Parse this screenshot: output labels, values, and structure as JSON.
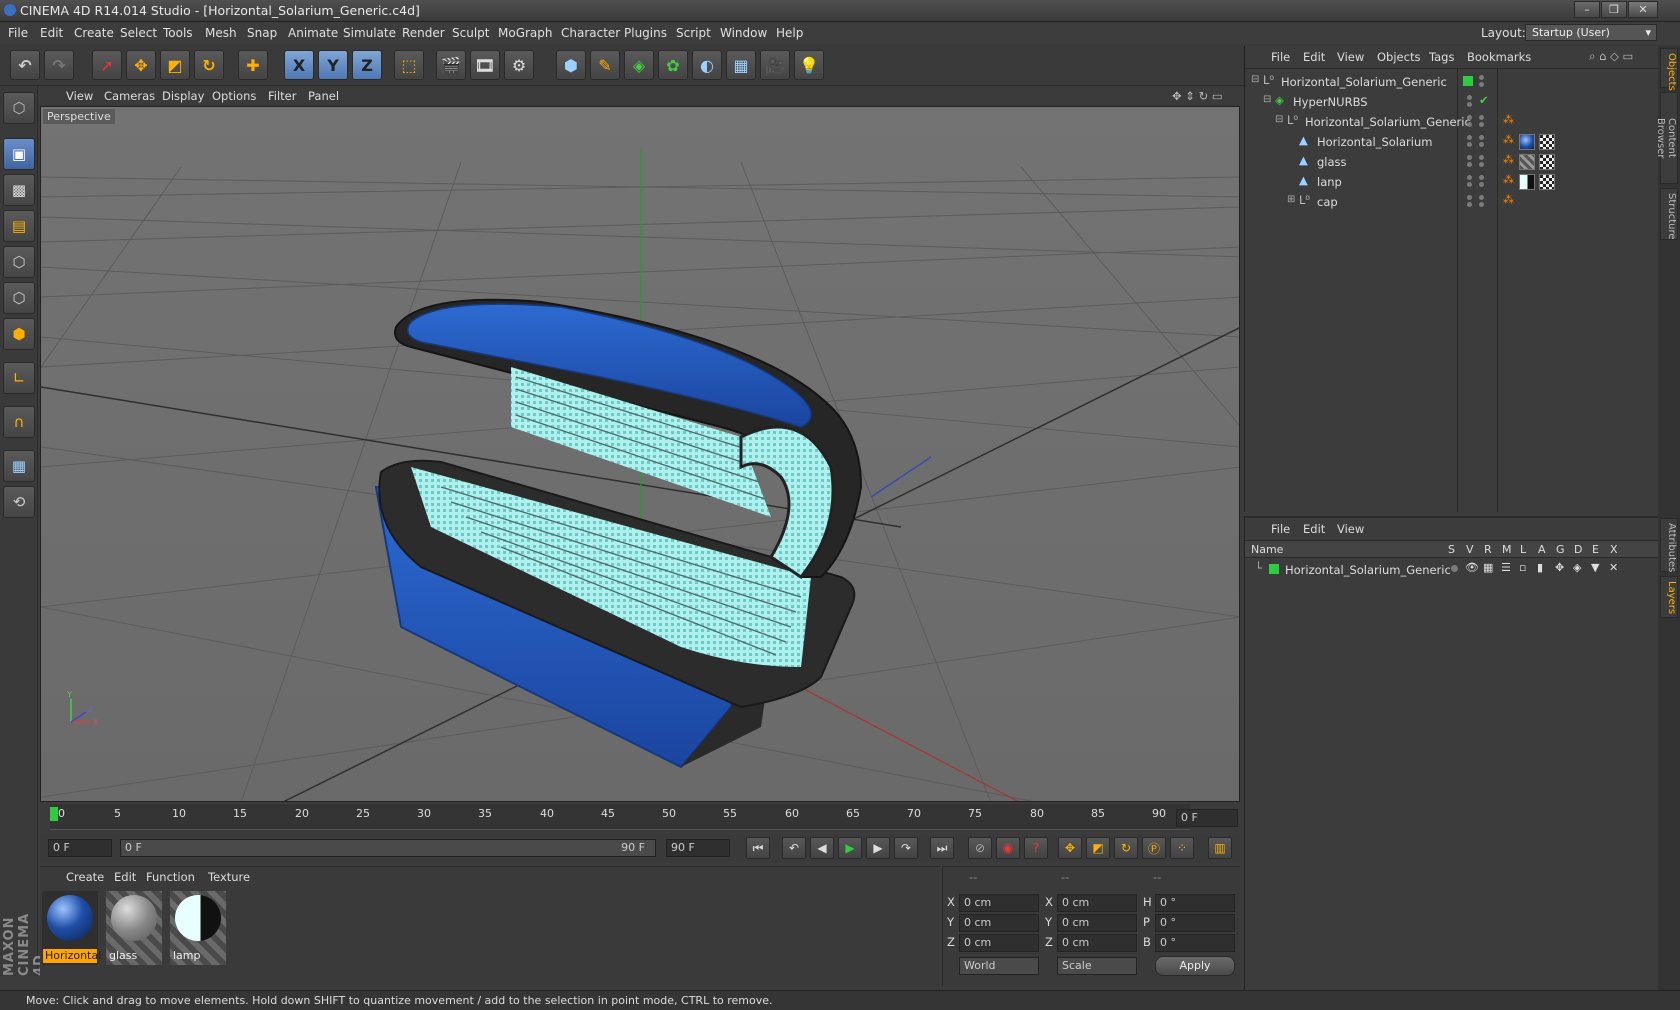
{
  "window": {
    "title": "CINEMA 4D R14.014 Studio - [Horizontal_Solarium_Generic.c4d]",
    "layout_label": "Layout:",
    "layout_value": "Startup (User)"
  },
  "menubar": [
    "File",
    "Edit",
    "Create",
    "Select",
    "Tools",
    "Mesh",
    "Snap",
    "Animate",
    "Simulate",
    "Render",
    "Sculpt",
    "MoGraph",
    "Character",
    "Plugins",
    "Script",
    "Window",
    "Help"
  ],
  "toolbar": {
    "icons": [
      "undo-icon",
      "redo-icon",
      "live-selection-icon",
      "move-icon",
      "scale-icon",
      "rotate-icon",
      "add-icon",
      "x-axis-icon",
      "y-axis-icon",
      "z-axis-icon",
      "coordinate-system-icon",
      "render-view-icon",
      "render-picture-viewer-icon",
      "edit-render-settings-icon",
      "cube-icon",
      "pen-spline-icon",
      "subdivision-surface-icon",
      "array-icon",
      "deformer-icon",
      "floor-icon",
      "camera-icon",
      "light-icon"
    ],
    "axis_labels": [
      "X",
      "Y",
      "Z"
    ]
  },
  "viewport": {
    "menu": [
      "View",
      "Cameras",
      "Display",
      "Options",
      "Filter",
      "Panel"
    ],
    "label": "Perspective"
  },
  "timeline": {
    "ticks": [
      "0",
      "5",
      "10",
      "15",
      "20",
      "25",
      "30",
      "35",
      "40",
      "45",
      "50",
      "55",
      "60",
      "65",
      "70",
      "75",
      "80",
      "85",
      "90"
    ],
    "current_frame": "0 F"
  },
  "transport": {
    "start": "0 F",
    "range_start": "0 F",
    "range_end": "90 F",
    "end": "90 F"
  },
  "material_panel": {
    "menu": [
      "Create",
      "Edit",
      "Function",
      "Texture"
    ],
    "materials": [
      {
        "name": "Horizontal",
        "selected": true,
        "color": "#1f4fa8"
      },
      {
        "name": "glass",
        "selected": false,
        "color": "#9a9a9a"
      },
      {
        "name": "lamp",
        "selected": false,
        "color": "#bff4f4"
      }
    ]
  },
  "coordinates": {
    "headers": [
      "--",
      "--",
      "--"
    ],
    "rows": [
      {
        "pos_axis": "X",
        "pos": "0 cm",
        "size_axis": "X",
        "size": "0 cm",
        "rot_axis": "H",
        "rot": "0 °"
      },
      {
        "pos_axis": "Y",
        "pos": "0 cm",
        "size_axis": "Y",
        "size": "0 cm",
        "rot_axis": "P",
        "rot": "0 °"
      },
      {
        "pos_axis": "Z",
        "pos": "0 cm",
        "size_axis": "Z",
        "size": "0 cm",
        "rot_axis": "B",
        "rot": "0 °"
      }
    ],
    "mode": "World",
    "type": "Scale",
    "apply": "Apply"
  },
  "object_manager": {
    "menu": [
      "File",
      "Edit",
      "View",
      "Objects",
      "Tags",
      "Bookmarks"
    ],
    "objects": [
      {
        "name": "Horizontal_Solarium_Generic",
        "indent": 0,
        "icon": "null-icon"
      },
      {
        "name": "HyperNURBS",
        "indent": 1,
        "icon": "hypernurbs-icon"
      },
      {
        "name": "Horizontal_Solarium_Generic",
        "indent": 2,
        "icon": "null-icon"
      },
      {
        "name": "Horizontal_Solarium",
        "indent": 3,
        "icon": "polygon-icon"
      },
      {
        "name": "glass",
        "indent": 3,
        "icon": "polygon-icon"
      },
      {
        "name": "lanp",
        "indent": 3,
        "icon": "polygon-icon"
      },
      {
        "name": "cap",
        "indent": 3,
        "icon": "null-icon"
      }
    ]
  },
  "layer_manager": {
    "menu": [
      "File",
      "Edit",
      "View"
    ],
    "columns": [
      "Name",
      "S",
      "V",
      "R",
      "M",
      "L",
      "A",
      "G",
      "D",
      "E",
      "X"
    ],
    "layers": [
      {
        "name": "Horizontal_Solarium_Generic",
        "color": "#2fc02f"
      }
    ]
  },
  "right_tabs": [
    "Objects",
    "Content Browser",
    "Structure",
    "Attributes",
    "Layers"
  ],
  "brand": "MAXON CINEMA 4D",
  "status": "Move: Click and drag to move elements. Hold down SHIFT to quantize movement / add to the selection in point mode, CTRL to remove."
}
